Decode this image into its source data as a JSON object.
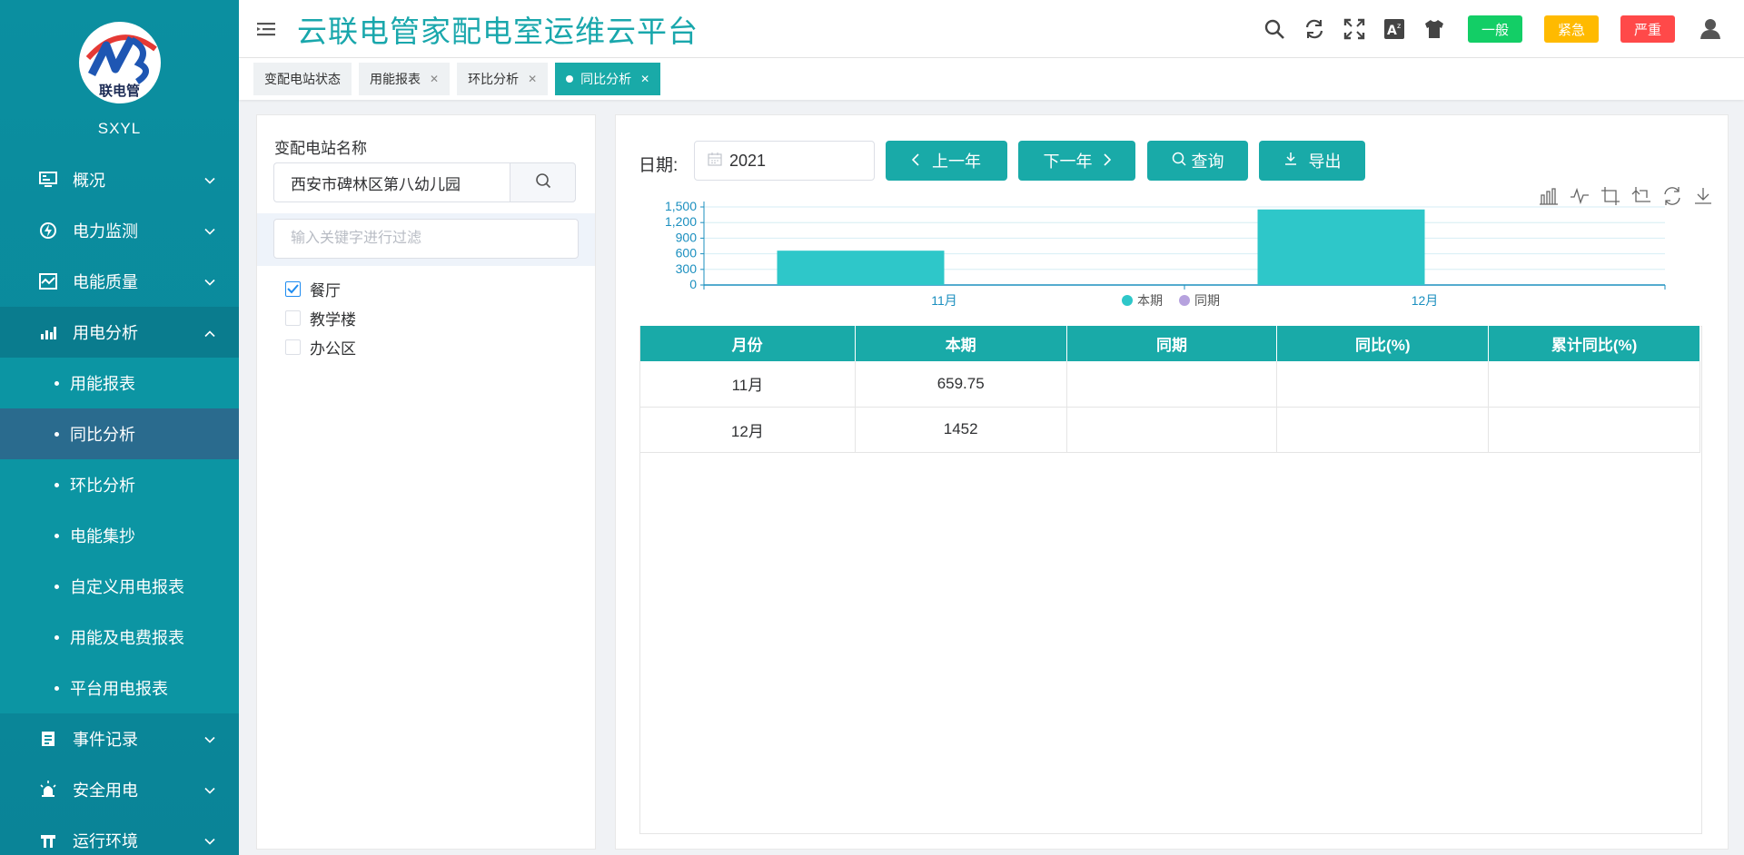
{
  "brand": {
    "logo_text": "联电管",
    "name": "SXYL"
  },
  "sidebar": {
    "items": [
      {
        "label": "概况",
        "icon": "monitor-icon"
      },
      {
        "label": "电力监测",
        "icon": "power-icon"
      },
      {
        "label": "电能质量",
        "icon": "quality-icon"
      },
      {
        "label": "用电分析",
        "icon": "bar-chart-icon",
        "open": true,
        "children": [
          "用能报表",
          "同比分析",
          "环比分析",
          "电能集抄",
          "自定义用电报表",
          "用能及电费报表",
          "平台用电报表"
        ],
        "active_child": "同比分析"
      },
      {
        "label": "事件记录",
        "icon": "record-icon"
      },
      {
        "label": "安全用电",
        "icon": "alarm-icon"
      },
      {
        "label": "运行环境",
        "icon": "environment-icon"
      }
    ]
  },
  "header": {
    "title": "云联电管家配电室运维云平台",
    "badges": [
      {
        "label": "一般",
        "color": "#13ce66"
      },
      {
        "label": "紧急",
        "color": "#ffba00"
      },
      {
        "label": "严重",
        "color": "#ff4949"
      }
    ],
    "icons": [
      "search-icon",
      "refresh-icon",
      "fullscreen-icon",
      "font-size-icon",
      "theme-shirt-icon",
      "user-icon"
    ]
  },
  "tabs": [
    {
      "label": "变配电站状态",
      "closable": false
    },
    {
      "label": "用能报表",
      "closable": true
    },
    {
      "label": "环比分析",
      "closable": true
    },
    {
      "label": "同比分析",
      "closable": true,
      "active": true
    }
  ],
  "left_panel": {
    "station_label": "变配电站名称",
    "station_value": "西安市碑林区第八幼儿园",
    "filter_placeholder": "输入关键字进行过滤",
    "tree": [
      {
        "label": "餐厅",
        "checked": true
      },
      {
        "label": "教学楼",
        "checked": false
      },
      {
        "label": "办公区",
        "checked": false
      }
    ]
  },
  "toolbar": {
    "date_label": "日期:",
    "date_value": "2021",
    "prev_label": "上一年",
    "next_label": "下一年",
    "query_label": "查询",
    "export_label": "导出"
  },
  "chart_data": {
    "type": "bar",
    "categories": [
      "11月",
      "12月"
    ],
    "series": [
      {
        "name": "本期",
        "values": [
          659.75,
          1452
        ],
        "color": "#2ec7c9"
      },
      {
        "name": "同期",
        "values": [
          null,
          null
        ],
        "color": "#b6a2de"
      }
    ],
    "yticks": [
      "0",
      "300",
      "600",
      "900",
      "1,200",
      "1,500"
    ],
    "ylim": [
      0,
      1500
    ],
    "legend": "bottom-center",
    "grid": true
  },
  "table": {
    "headers": [
      "月份",
      "本期",
      "同期",
      "同比(%)",
      "累计同比(%)"
    ],
    "rows": [
      [
        "11月",
        "659.75",
        "",
        "",
        ""
      ],
      [
        "12月",
        "1452",
        "",
        "",
        ""
      ]
    ]
  }
}
